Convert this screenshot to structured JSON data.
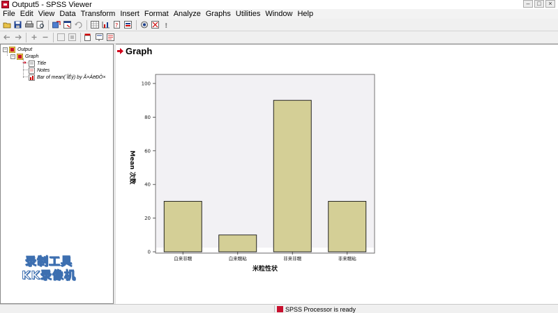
{
  "window": {
    "title": "Output5 - SPSS Viewer"
  },
  "menu": [
    "File",
    "Edit",
    "View",
    "Data",
    "Transform",
    "Insert",
    "Format",
    "Analyze",
    "Graphs",
    "Utilities",
    "Window",
    "Help"
  ],
  "toolbar1": [
    "open-icon",
    "save-icon",
    "print-icon",
    "print-preview-icon",
    "export-icon",
    "dialog-recall-icon",
    "undo-icon",
    "goto-data-icon",
    "goto-case-icon",
    "variables-icon",
    "use-sets-icon",
    "select-last-output-icon",
    "designate-window-icon",
    "help-icon"
  ],
  "toolbar2": [
    "promote-icon",
    "demote-icon",
    "expand-icon",
    "collapse-icon",
    "show-icon",
    "hide-icon",
    "insert-heading-icon",
    "insert-title-icon",
    "insert-text-icon"
  ],
  "outline": {
    "root": "Output",
    "child": "Graph",
    "items": [
      "Title",
      "Notes",
      "Bar of mean(´ÎÊý) by Ã×ÁëÐÔ×"
    ]
  },
  "content": {
    "heading": "Graph"
  },
  "chart_data": {
    "type": "bar",
    "categories": [
      "白来非糯",
      "白来糯粘",
      "非来非糯",
      "非来糯粘"
    ],
    "values": [
      30,
      10,
      90,
      30
    ],
    "ylim": [
      0,
      100
    ],
    "yticks": [
      0,
      20,
      40,
      60,
      80,
      100
    ],
    "xlabel": "米粒性状",
    "ylabel": "Mean 次数",
    "grid": false,
    "bar_color": "#d4cf96",
    "plot_background": "#f2f1f4"
  },
  "status": {
    "text": "SPSS Processor  is ready"
  },
  "watermark": {
    "line1": "录制工具",
    "line2": "KK录像机"
  }
}
